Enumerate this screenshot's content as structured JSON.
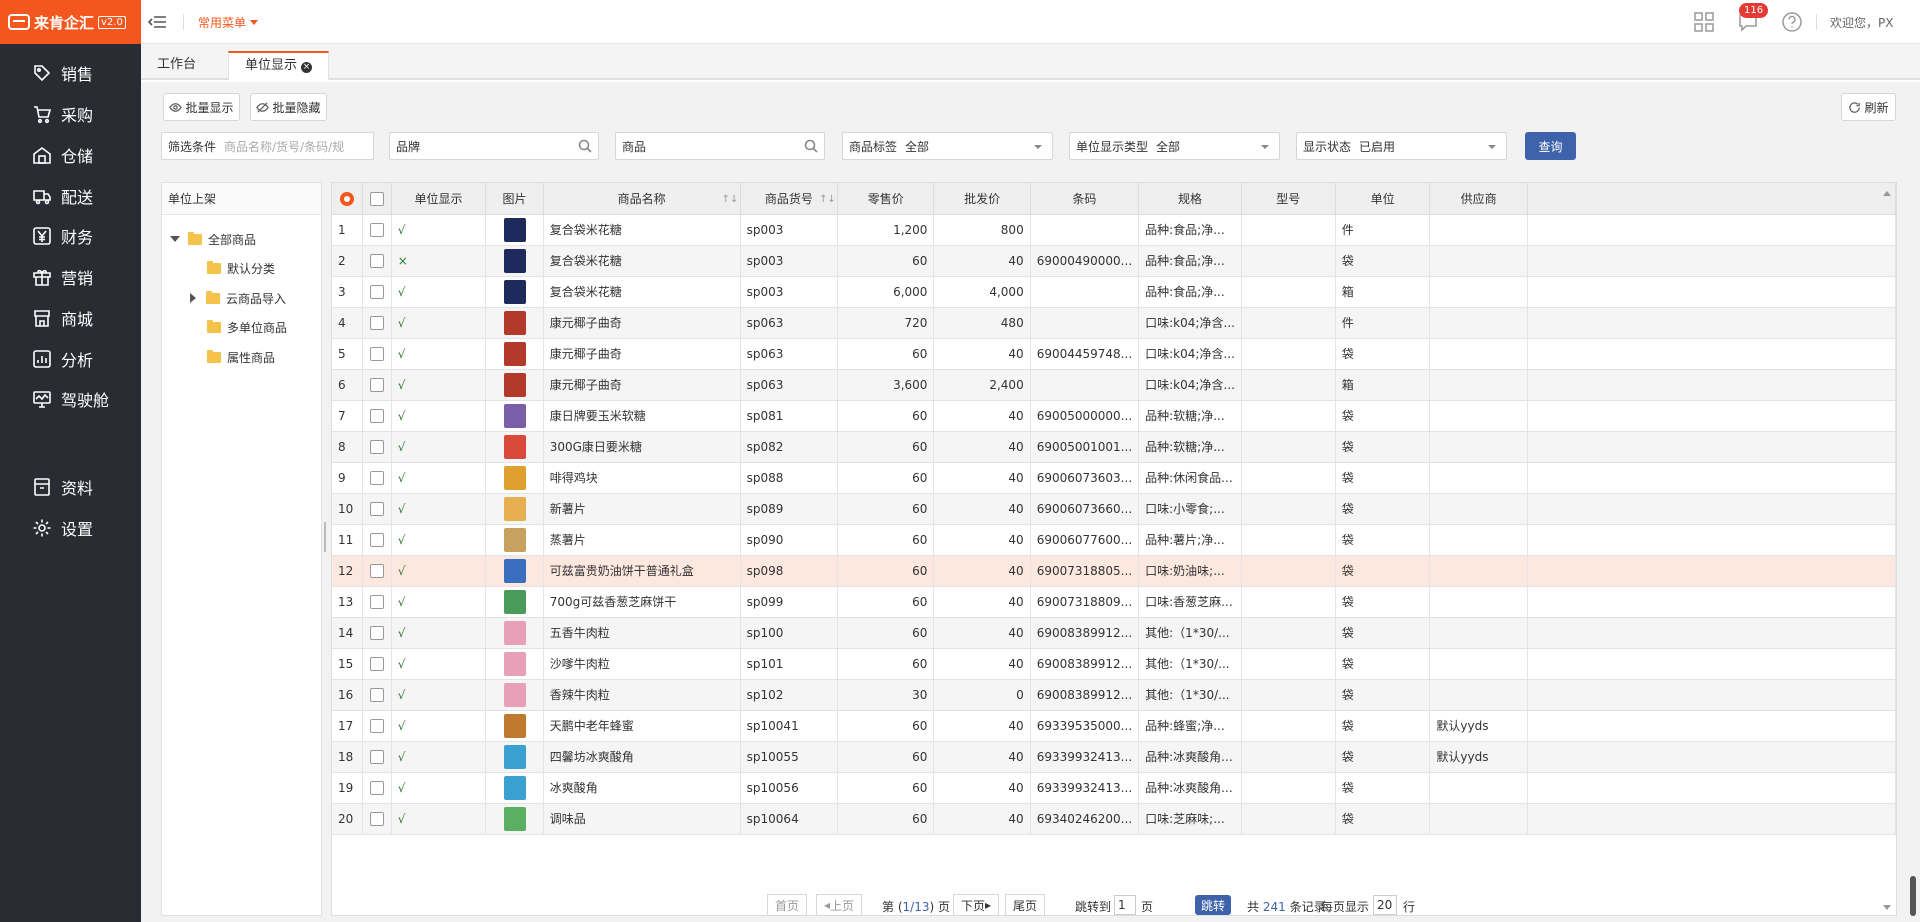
{
  "app": {
    "logo": "来肯企汇",
    "version": "v2.0"
  },
  "sidebar": {
    "items": [
      {
        "label": "销售",
        "icon": "tag-icon"
      },
      {
        "label": "采购",
        "icon": "cart-icon"
      },
      {
        "label": "仓储",
        "icon": "warehouse-icon"
      },
      {
        "label": "配送",
        "icon": "truck-icon"
      },
      {
        "label": "财务",
        "icon": "yen-icon"
      },
      {
        "label": "营销",
        "icon": "gift-icon"
      },
      {
        "label": "商城",
        "icon": "store-icon"
      },
      {
        "label": "分析",
        "icon": "chart-icon"
      },
      {
        "label": "驾驶舱",
        "icon": "monitor-icon"
      },
      {
        "label": "资料",
        "icon": "archive-icon"
      },
      {
        "label": "设置",
        "icon": "gear-icon"
      }
    ]
  },
  "topbar": {
    "common_menu": "常用菜单",
    "badge": "116",
    "welcome": "欢迎您，PX"
  },
  "tabs": [
    {
      "label": "工作台"
    },
    {
      "label": "单位显示"
    }
  ],
  "toolbar": {
    "batch_show": "批量显示",
    "batch_hide": "批量隐藏",
    "refresh": "刷新"
  },
  "filters": {
    "filter_label": "筛选条件",
    "filter_placeholder": "商品名称/货号/条码/规",
    "brand_placeholder": "品牌",
    "goods_placeholder": "商品",
    "tag_label": "商品标签",
    "tag_value": "全部",
    "unit_type_label": "单位显示类型",
    "unit_type_value": "全部",
    "status_label": "显示状态",
    "status_value": "已启用",
    "query": "查询"
  },
  "tree": {
    "title": "单位上架",
    "root": "全部商品",
    "children": [
      "默认分类",
      "云商品导入",
      "多单位商品",
      "属性商品"
    ]
  },
  "table": {
    "headers": [
      "单位显示",
      "图片",
      "商品名称",
      "商品货号",
      "零售价",
      "批发价",
      "条码",
      "规格",
      "型号",
      "单位",
      "供应商"
    ],
    "rows": [
      {
        "no": "1",
        "show": "√",
        "name": "复合袋米花糖",
        "sku": "sp003",
        "retail": "1,200",
        "wholesale": "800",
        "barcode": "",
        "spec": "品种:食品;净...",
        "model": "",
        "unit": "件",
        "supplier": "",
        "img": "#1e2a5c"
      },
      {
        "no": "2",
        "show": "×",
        "name": "复合袋米花糖",
        "sku": "sp003",
        "retail": "60",
        "wholesale": "40",
        "barcode": "69000490000...",
        "spec": "品种:食品;净...",
        "model": "",
        "unit": "袋",
        "supplier": "",
        "img": "#1e2a5c"
      },
      {
        "no": "3",
        "show": "√",
        "name": "复合袋米花糖",
        "sku": "sp003",
        "retail": "6,000",
        "wholesale": "4,000",
        "barcode": "",
        "spec": "品种:食品;净...",
        "model": "",
        "unit": "箱",
        "supplier": "",
        "img": "#1e2a5c"
      },
      {
        "no": "4",
        "show": "√",
        "name": "康元椰子曲奇",
        "sku": "sp063",
        "retail": "720",
        "wholesale": "480",
        "barcode": "",
        "spec": "口味:k04;净含...",
        "model": "",
        "unit": "件",
        "supplier": "",
        "img": "#b33a2a"
      },
      {
        "no": "5",
        "show": "√",
        "name": "康元椰子曲奇",
        "sku": "sp063",
        "retail": "60",
        "wholesale": "40",
        "barcode": "69004459748...",
        "spec": "口味:k04;净含...",
        "model": "",
        "unit": "袋",
        "supplier": "",
        "img": "#b33a2a"
      },
      {
        "no": "6",
        "show": "√",
        "name": "康元椰子曲奇",
        "sku": "sp063",
        "retail": "3,600",
        "wholesale": "2,400",
        "barcode": "",
        "spec": "口味:k04;净含...",
        "model": "",
        "unit": "箱",
        "supplier": "",
        "img": "#b33a2a"
      },
      {
        "no": "7",
        "show": "√",
        "name": "康日牌要玉米软糖",
        "sku": "sp081",
        "retail": "60",
        "wholesale": "40",
        "barcode": "69005000000...",
        "spec": "品种:软糖;净...",
        "model": "",
        "unit": "袋",
        "supplier": "",
        "img": "#7a5fa8"
      },
      {
        "no": "8",
        "show": "√",
        "name": "300G康日要米糖",
        "sku": "sp082",
        "retail": "60",
        "wholesale": "40",
        "barcode": "69005001001...",
        "spec": "品种:软糖;净...",
        "model": "",
        "unit": "袋",
        "supplier": "",
        "img": "#d94a3a"
      },
      {
        "no": "9",
        "show": "√",
        "name": "啡得鸡块",
        "sku": "sp088",
        "retail": "60",
        "wholesale": "40",
        "barcode": "69006073603...",
        "spec": "品种:休闲食品...",
        "model": "",
        "unit": "袋",
        "supplier": "",
        "img": "#e0a030"
      },
      {
        "no": "10",
        "show": "√",
        "name": "新薯片",
        "sku": "sp089",
        "retail": "60",
        "wholesale": "40",
        "barcode": "69006073660...",
        "spec": "口味:小零食;...",
        "model": "",
        "unit": "袋",
        "supplier": "",
        "img": "#e6b050"
      },
      {
        "no": "11",
        "show": "√",
        "name": "蒸薯片",
        "sku": "sp090",
        "retail": "60",
        "wholesale": "40",
        "barcode": "69006077600...",
        "spec": "品种:薯片;净...",
        "model": "",
        "unit": "袋",
        "supplier": "",
        "img": "#c8a060"
      },
      {
        "no": "12",
        "show": "√",
        "name": "可兹富贵奶油饼干普通礼盒",
        "sku": "sp098",
        "retail": "60",
        "wholesale": "40",
        "barcode": "69007318805...",
        "spec": "口味:奶油味;...",
        "model": "",
        "unit": "袋",
        "supplier": "",
        "img": "#3a6fc0"
      },
      {
        "no": "13",
        "show": "√",
        "name": "700g可兹香葱芝麻饼干",
        "sku": "sp099",
        "retail": "60",
        "wholesale": "40",
        "barcode": "69007318809...",
        "spec": "口味:香葱芝麻...",
        "model": "",
        "unit": "袋",
        "supplier": "",
        "img": "#4a9a5a"
      },
      {
        "no": "14",
        "show": "√",
        "name": "五香牛肉粒",
        "sku": "sp100",
        "retail": "60",
        "wholesale": "40",
        "barcode": "69008389912...",
        "spec": "其他:（1*30/...",
        "model": "",
        "unit": "袋",
        "supplier": "",
        "img": "#e8a0b8"
      },
      {
        "no": "15",
        "show": "√",
        "name": "沙嗲牛肉粒",
        "sku": "sp101",
        "retail": "60",
        "wholesale": "40",
        "barcode": "69008389912...",
        "spec": "其他:（1*30/...",
        "model": "",
        "unit": "袋",
        "supplier": "",
        "img": "#e8a0b8"
      },
      {
        "no": "16",
        "show": "√",
        "name": "香辣牛肉粒",
        "sku": "sp102",
        "retail": "30",
        "wholesale": "0",
        "barcode": "69008389912...",
        "spec": "其他:（1*30/...",
        "model": "",
        "unit": "袋",
        "supplier": "",
        "img": "#e8a0b8"
      },
      {
        "no": "17",
        "show": "√",
        "name": "天鹏中老年蜂蜜",
        "sku": "sp10041",
        "retail": "60",
        "wholesale": "40",
        "barcode": "69339535000...",
        "spec": "品种:蜂蜜;净...",
        "model": "",
        "unit": "袋",
        "supplier": "默认yyds",
        "img": "#c07a30"
      },
      {
        "no": "18",
        "show": "√",
        "name": "四馨坊冰爽酸角",
        "sku": "sp10055",
        "retail": "60",
        "wholesale": "40",
        "barcode": "69339932413...",
        "spec": "品种:冰爽酸角...",
        "model": "",
        "unit": "袋",
        "supplier": "默认yyds",
        "img": "#3aa0d0"
      },
      {
        "no": "19",
        "show": "√",
        "name": "冰爽酸角",
        "sku": "sp10056",
        "retail": "60",
        "wholesale": "40",
        "barcode": "69339932413...",
        "spec": "品种:冰爽酸角...",
        "model": "",
        "unit": "袋",
        "supplier": "",
        "img": "#3aa0d0"
      },
      {
        "no": "20",
        "show": "√",
        "name": "调味品",
        "sku": "sp10064",
        "retail": "60",
        "wholesale": "40",
        "barcode": "69340246200...",
        "spec": "口味:芝麻味;...",
        "model": "",
        "unit": "袋",
        "supplier": "",
        "img": "#5ab060"
      }
    ]
  },
  "pager": {
    "first": "首页",
    "prev": "上页",
    "page_info_pre": "第 (",
    "page_current": "1",
    "page_sep": "/",
    "page_total": "13",
    "page_info_post": ") 页",
    "next": "下页",
    "last": "尾页",
    "jump_label": "跳转到",
    "jump_value": "1",
    "jump_unit": "页",
    "go": "跳转",
    "total_pre": "共",
    "total": "241",
    "total_post": "条记录",
    "per_page_label": "每页显示",
    "per_page": "20",
    "per_page_unit": "行"
  }
}
